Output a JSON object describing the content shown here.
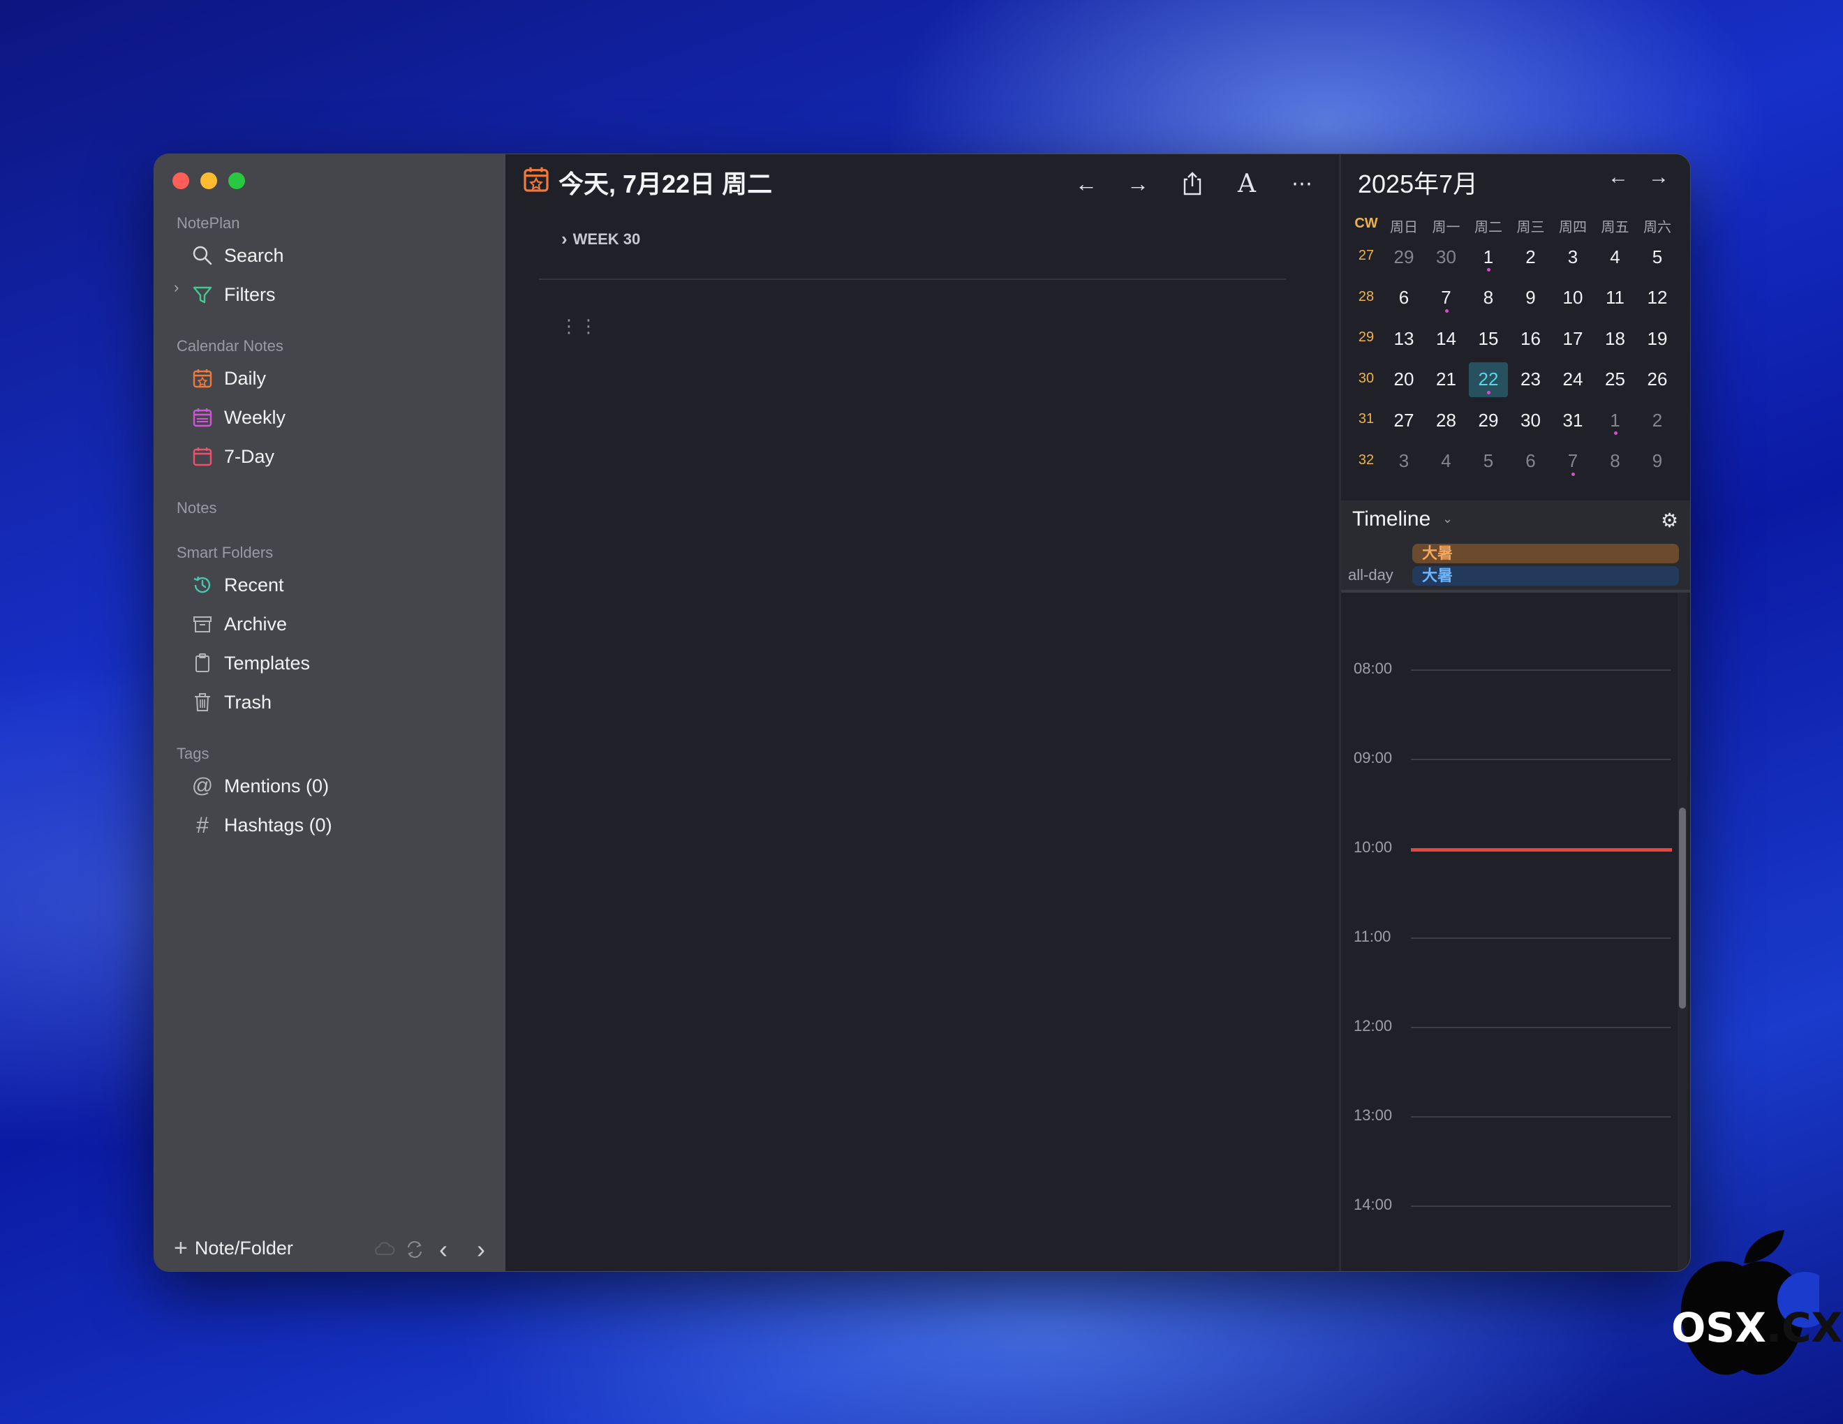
{
  "window": {
    "traffic_colors": {
      "close": "#ff5f57",
      "minimize": "#febc2e",
      "zoom": "#28c840"
    }
  },
  "sidebar": {
    "app_section": "NotePlan",
    "search_label": "Search",
    "filters_label": "Filters",
    "calendar_section": "Calendar Notes",
    "calendar_items": [
      {
        "label": "Daily",
        "icon": "calendar-star-icon",
        "color": "#f07a3a"
      },
      {
        "label": "Weekly",
        "icon": "calendar-week-icon",
        "color": "#d055d8"
      },
      {
        "label": "7-Day",
        "icon": "calendar-icon",
        "color": "#f0506e"
      }
    ],
    "notes_section": "Notes",
    "smart_section": "Smart Folders",
    "smart_items": [
      {
        "label": "Recent",
        "icon": "history-icon",
        "color": "#49c6b0"
      },
      {
        "label": "Archive",
        "icon": "archive-icon",
        "color": "#b6b7bd"
      },
      {
        "label": "Templates",
        "icon": "clipboard-icon",
        "color": "#b6b7bd"
      },
      {
        "label": "Trash",
        "icon": "trash-icon",
        "color": "#b6b7bd"
      }
    ],
    "tags_section": "Tags",
    "tag_items": [
      {
        "label": "Mentions (0)",
        "icon": "at-icon"
      },
      {
        "label": "Hashtags (0)",
        "icon": "hash-icon"
      }
    ],
    "new_note_label": "Note/Folder"
  },
  "editor": {
    "title": "今天, 7月22日 周二",
    "title_icon_color": "#f07a3a",
    "week_label": "WEEK 30"
  },
  "calendar": {
    "month_title": "2025年7月",
    "cw_label": "CW",
    "weekdays": [
      "周日",
      "周一",
      "周二",
      "周三",
      "周四",
      "周五",
      "周六"
    ],
    "today_color": "#5cd3e8",
    "dot_color": "#d64ec9",
    "weeks": [
      {
        "cw": "27",
        "days": [
          {
            "d": "29",
            "dim": true
          },
          {
            "d": "30",
            "dim": true
          },
          {
            "d": "1",
            "dot": true
          },
          {
            "d": "2"
          },
          {
            "d": "3"
          },
          {
            "d": "4"
          },
          {
            "d": "5"
          }
        ]
      },
      {
        "cw": "28",
        "days": [
          {
            "d": "6"
          },
          {
            "d": "7",
            "dot": true
          },
          {
            "d": "8"
          },
          {
            "d": "9"
          },
          {
            "d": "10"
          },
          {
            "d": "11"
          },
          {
            "d": "12"
          }
        ]
      },
      {
        "cw": "29",
        "days": [
          {
            "d": "13"
          },
          {
            "d": "14"
          },
          {
            "d": "15"
          },
          {
            "d": "16"
          },
          {
            "d": "17"
          },
          {
            "d": "18"
          },
          {
            "d": "19"
          }
        ]
      },
      {
        "cw": "30",
        "days": [
          {
            "d": "20"
          },
          {
            "d": "21"
          },
          {
            "d": "22",
            "today": true,
            "dot": true
          },
          {
            "d": "23"
          },
          {
            "d": "24"
          },
          {
            "d": "25"
          },
          {
            "d": "26"
          }
        ]
      },
      {
        "cw": "31",
        "days": [
          {
            "d": "27"
          },
          {
            "d": "28"
          },
          {
            "d": "29"
          },
          {
            "d": "30"
          },
          {
            "d": "31"
          },
          {
            "d": "1",
            "dim": true,
            "dot": true
          },
          {
            "d": "2",
            "dim": true
          }
        ]
      },
      {
        "cw": "32",
        "days": [
          {
            "d": "3",
            "dim": true
          },
          {
            "d": "4",
            "dim": true
          },
          {
            "d": "5",
            "dim": true
          },
          {
            "d": "6",
            "dim": true
          },
          {
            "d": "7",
            "dim": true,
            "dot": true
          },
          {
            "d": "8",
            "dim": true
          },
          {
            "d": "9",
            "dim": true
          }
        ]
      }
    ]
  },
  "timeline": {
    "title": "Timeline",
    "allday_label": "all-day",
    "events": [
      {
        "label": "大暑",
        "bg": "#6b4a2e",
        "color": "#f4a65c"
      },
      {
        "label": "大暑",
        "bg": "#243a5c",
        "color": "#6cb6ff"
      }
    ],
    "hours": [
      "08:00",
      "09:00",
      "10:00",
      "11:00",
      "12:00",
      "13:00",
      "14:00"
    ],
    "current_time_color": "#e8463c"
  },
  "watermark": {
    "text_a": "OSX",
    "text_b": ".CX"
  }
}
